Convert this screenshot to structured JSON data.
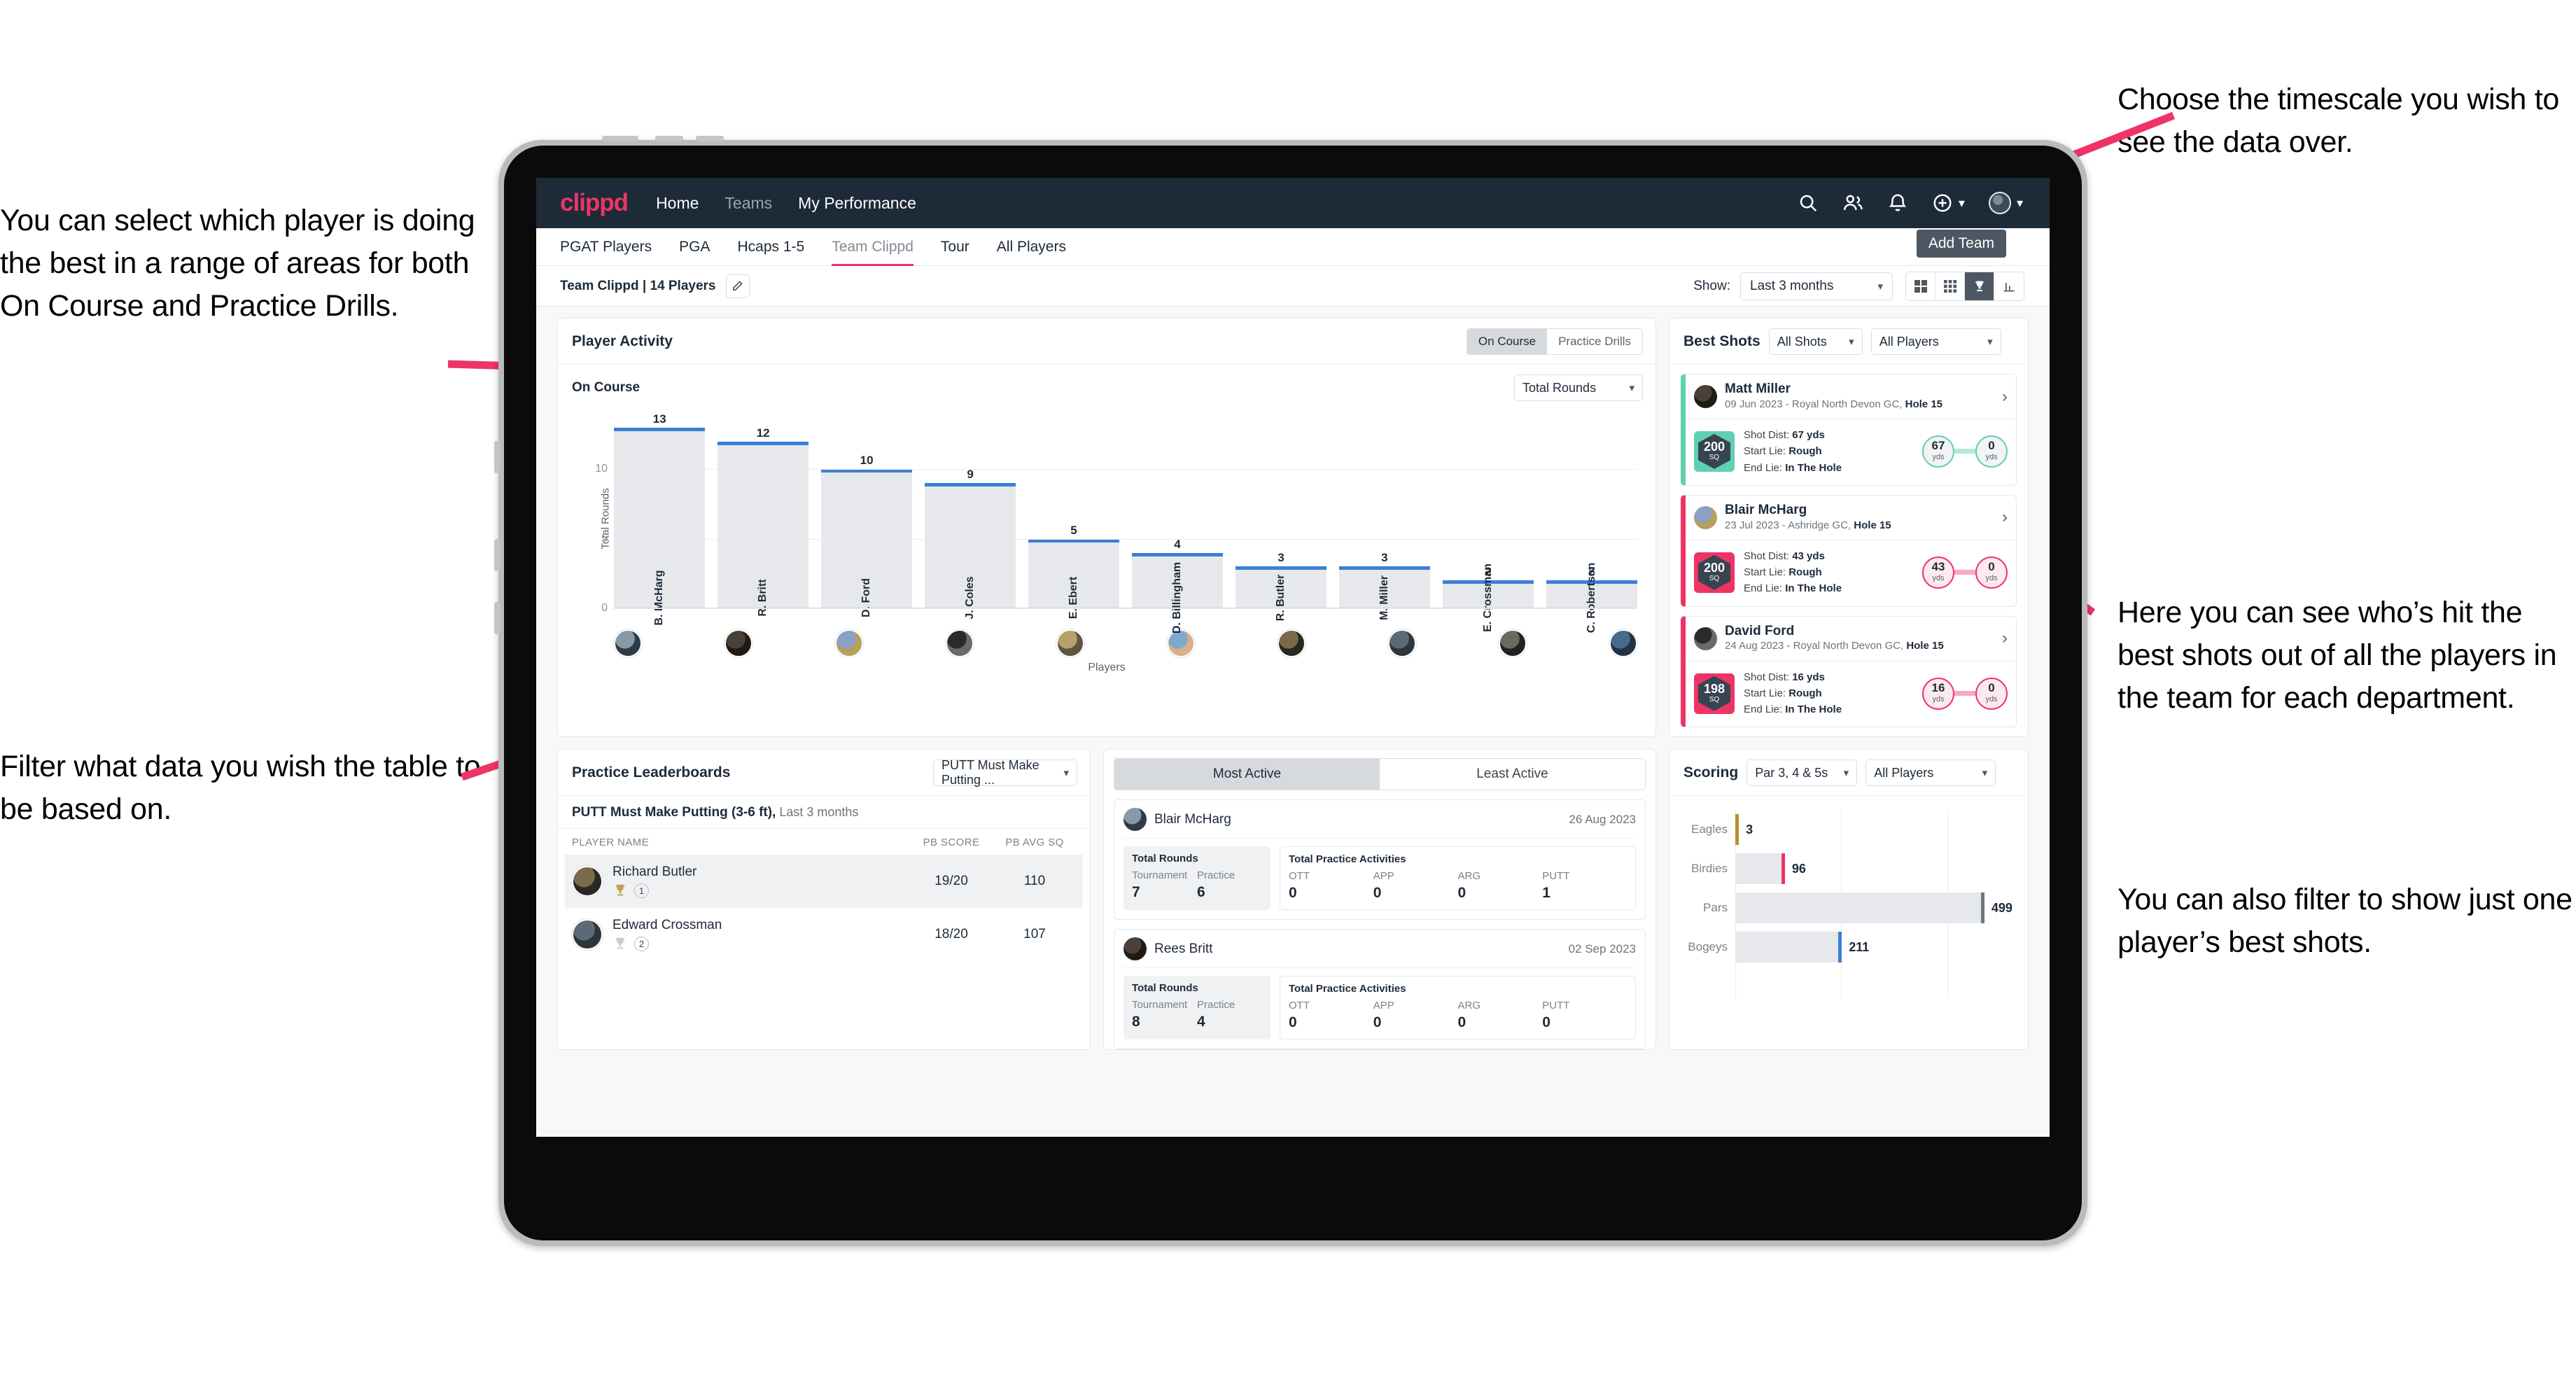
{
  "annotations": {
    "left_top": "You can select which player is doing the best in a range of areas for both On Course and Practice Drills.",
    "left_bottom": "Filter what data you wish the table to be based on.",
    "right_top": "Choose the timescale you wish to see the data over.",
    "right_middle": "Here you can see who’s hit the best shots out of all the players in the team for each department.",
    "right_bottom": "You can also filter to show just one player’s best shots."
  },
  "nav": {
    "logo": "clippd",
    "links": [
      {
        "label": "Home",
        "active": true
      },
      {
        "label": "Teams",
        "active": false
      },
      {
        "label": "My Performance",
        "active": true
      }
    ],
    "icons": [
      "search-icon",
      "people-icon",
      "bell-icon",
      "plus-circle-icon",
      "avatar"
    ]
  },
  "subtabs": {
    "items": [
      {
        "label": "PGAT Players",
        "active": false
      },
      {
        "label": "PGA",
        "active": false
      },
      {
        "label": "Hcaps 1-5",
        "active": false
      },
      {
        "label": "Team Clippd",
        "active": true
      },
      {
        "label": "Tour",
        "active": false
      },
      {
        "label": "All Players",
        "active": false
      }
    ],
    "tooltip": "Add Team"
  },
  "toolbar": {
    "team_label": "Team Clippd | 14 Players",
    "edit_icon": "pencil-icon",
    "show_label": "Show:",
    "period_value": "Last 3 months",
    "view_buttons": [
      {
        "name": "grid-2x2-icon",
        "active": false
      },
      {
        "name": "grid-3x3-icon",
        "active": false
      },
      {
        "name": "trophy-icon",
        "active": true
      },
      {
        "name": "bar-chart-icon",
        "active": false
      }
    ]
  },
  "player_activity": {
    "title": "Player Activity",
    "segments": [
      {
        "label": "On Course",
        "active": true
      },
      {
        "label": "Practice Drills",
        "active": false
      }
    ],
    "sub_label": "On Course",
    "metric_select": "Total Rounds"
  },
  "chart_data": [
    {
      "type": "bar",
      "title": "Player Activity — On Course",
      "categories": [
        "B. McHarg",
        "R. Britt",
        "D. Ford",
        "J. Coles",
        "E. Ebert",
        "D. Billingham",
        "R. Butler",
        "M. Miller",
        "E. Crossman",
        "C. Robertson"
      ],
      "values": [
        13,
        12,
        10,
        9,
        5,
        4,
        3,
        3,
        2,
        2
      ],
      "xlabel": "Players",
      "ylabel": "Total Rounds",
      "ylim": [
        0,
        14
      ],
      "yticks": [
        0,
        5,
        10
      ],
      "grid": true,
      "legend": "none",
      "bar_color": "#e6e8ec",
      "cap_color": "#3b7fd4"
    },
    {
      "type": "bar",
      "orientation": "horizontal",
      "title": "Scoring",
      "categories": [
        "Eagles",
        "Birdies",
        "Pars",
        "Bogeys"
      ],
      "values": [
        3,
        96,
        499,
        211
      ],
      "cap_colors": [
        "#b5902f",
        "#ee3465",
        "#6d7780",
        "#3b7fd4"
      ],
      "xlabel": "",
      "ylabel": "",
      "xlim": [
        0,
        560
      ],
      "grid": true,
      "legend": "none"
    }
  ],
  "best_shots": {
    "title": "Best Shots",
    "filter_shots": "All Shots",
    "filter_players": "All Players",
    "cards": [
      {
        "player": "Matt Miller",
        "meta_prefix": "09 Jun 2023 - Royal North Devon GC, ",
        "meta_hole": "Hole 15",
        "sq_value": "200",
        "sq_unit": "SQ",
        "accent": "teal",
        "shot_dist_label": "Shot Dist: ",
        "shot_dist": "67 yds",
        "start_lie_label": "Start Lie: ",
        "start_lie": "Rough",
        "end_lie_label": "End Lie: ",
        "end_lie": "In The Hole",
        "from_value": "67",
        "from_unit": "yds",
        "to_value": "0",
        "to_unit": "yds"
      },
      {
        "player": "Blair McHarg",
        "meta_prefix": "23 Jul 2023 - Ashridge GC, ",
        "meta_hole": "Hole 15",
        "sq_value": "200",
        "sq_unit": "SQ",
        "accent": "pink",
        "shot_dist_label": "Shot Dist: ",
        "shot_dist": "43 yds",
        "start_lie_label": "Start Lie: ",
        "start_lie": "Rough",
        "end_lie_label": "End Lie: ",
        "end_lie": "In The Hole",
        "from_value": "43",
        "from_unit": "yds",
        "to_value": "0",
        "to_unit": "yds"
      },
      {
        "player": "David Ford",
        "meta_prefix": "24 Aug 2023 - Royal North Devon GC, ",
        "meta_hole": "Hole 15",
        "sq_value": "198",
        "sq_unit": "SQ",
        "accent": "pink",
        "shot_dist_label": "Shot Dist: ",
        "shot_dist": "16 yds",
        "start_lie_label": "Start Lie: ",
        "start_lie": "Rough",
        "end_lie_label": "End Lie: ",
        "end_lie": "In The Hole",
        "from_value": "16",
        "from_unit": "yds",
        "to_value": "0",
        "to_unit": "yds"
      }
    ]
  },
  "practice_leaderboards": {
    "title": "Practice Leaderboards",
    "drill_select": "PUTT Must Make Putting ...",
    "subtitle_bold": "PUTT Must Make Putting (3-6 ft),",
    "subtitle_rest": " Last 3 months",
    "columns": [
      "PLAYER NAME",
      "PB SCORE",
      "PB AVG SQ"
    ],
    "rows": [
      {
        "name": "Richard Butler",
        "rank": "1",
        "trophy": "gold",
        "pb_score": "19/20",
        "pb_avg_sq": "110"
      },
      {
        "name": "Edward Crossman",
        "rank": "2",
        "trophy": "silver",
        "pb_score": "18/20",
        "pb_avg_sq": "107"
      }
    ]
  },
  "activity_panel": {
    "tabs": [
      {
        "label": "Most Active",
        "active": true
      },
      {
        "label": "Least Active",
        "active": false
      }
    ],
    "cards": [
      {
        "player": "Blair McHarg",
        "date": "26 Aug 2023",
        "rounds_title": "Total Rounds",
        "rounds": [
          {
            "key": "Tournament",
            "value": "7"
          },
          {
            "key": "Practice",
            "value": "6"
          }
        ],
        "practice_title": "Total Practice Activities",
        "practice": [
          {
            "key": "OTT",
            "value": "0"
          },
          {
            "key": "APP",
            "value": "0"
          },
          {
            "key": "ARG",
            "value": "0"
          },
          {
            "key": "PUTT",
            "value": "1"
          }
        ]
      },
      {
        "player": "Rees Britt",
        "date": "02 Sep 2023",
        "rounds_title": "Total Rounds",
        "rounds": [
          {
            "key": "Tournament",
            "value": "8"
          },
          {
            "key": "Practice",
            "value": "4"
          }
        ],
        "practice_title": "Total Practice Activities",
        "practice": [
          {
            "key": "OTT",
            "value": "0"
          },
          {
            "key": "APP",
            "value": "0"
          },
          {
            "key": "ARG",
            "value": "0"
          },
          {
            "key": "PUTT",
            "value": "0"
          }
        ]
      }
    ]
  },
  "scoring": {
    "title": "Scoring",
    "filter_par": "Par 3, 4 & 5s",
    "filter_players": "All Players"
  },
  "colors": {
    "brand_pink": "#ee3465",
    "navy": "#1d2a38",
    "blue": "#3b7fd4",
    "teal": "#5fd0b0",
    "gold": "#b5902f"
  }
}
